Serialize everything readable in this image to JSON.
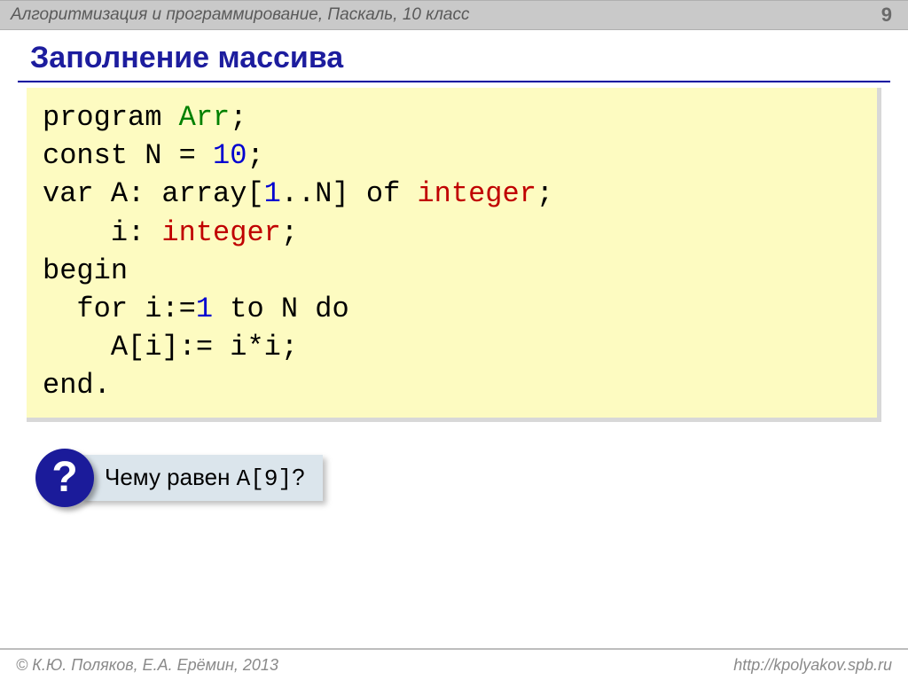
{
  "header": {
    "title": "Алгоритмизация и программирование, Паскаль, 10 класс",
    "page_number": "9"
  },
  "main": {
    "title": "Заполнение массива"
  },
  "code": {
    "l1_a": "program ",
    "l1_b": "Arr",
    "l1_c": ";",
    "l2_a": "const N",
    "l2_eq": " = ",
    "l2_b": "10",
    "l2_c": ";",
    "l3_a": "var A: array[",
    "l3_b": "1",
    "l3_c": "..N] of ",
    "l3_d": "integer",
    "l3_e": ";",
    "l4_a": "    i: ",
    "l4_b": "integer",
    "l4_c": ";",
    "l5": "begin",
    "l6_a": "  for i:=",
    "l6_b": "1",
    "l6_c": " to N do",
    "l7": "    A[i]:= i*i;",
    "l8": "end."
  },
  "question": {
    "mark": "?",
    "pre": "Чему равен ",
    "mono": "A[9]",
    "post": "?"
  },
  "footer": {
    "left": "© К.Ю. Поляков, Е.А. Ерёмин, 2013",
    "right": "http://kpolyakov.spb.ru"
  }
}
